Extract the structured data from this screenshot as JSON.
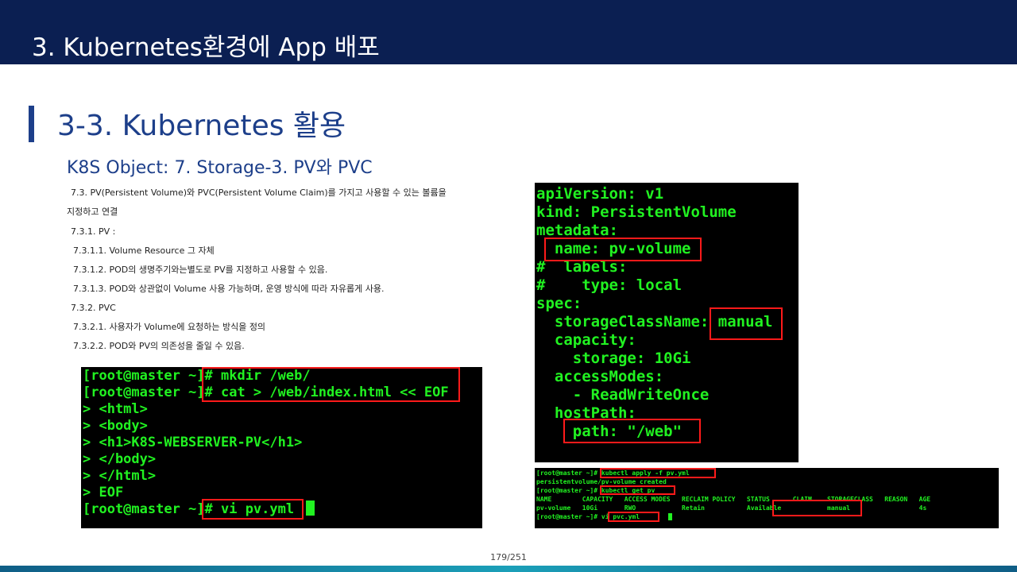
{
  "header": {
    "title": "3.  Kubernetes환경에 App 배포"
  },
  "section": {
    "title": "3-3. Kubernetes 활용"
  },
  "subtitle": "K8S Object: 7. Storage-3. PV와 PVC",
  "body_lines": [
    "7.3. PV(Persistent Volume)와 PVC(Persistent Volume Claim)를 가지고 사용할 수 있는 볼륨을",
    "지정하고 연결",
    "7.3.1. PV :",
    "7.3.1.1. Volume Resource 그 자체",
    "7.3.1.2. POD의 생명주기와는별도로 PV를 지정하고 사용할 수 있음.",
    "7.3.1.3. POD와 상관없이 Volume 사용 가능하며, 운영 방식에 따라 자유롭게 사용.",
    "7.3.2. PVC",
    "7.3.2.1. 사용자가 Volume에 요청하는 방식을 정의",
    "7.3.2.2. POD와 PV의 의존성을 줄일 수 있음."
  ],
  "terminal_left": {
    "lines": [
      "[root@master ~]# mkdir /web/",
      "[root@master ~]# cat > /web/index.html << EOF",
      "> <html>",
      "> <body>",
      "> <h1>K8S-WEBSERVER-PV</h1>",
      "> </body>",
      "> </html>",
      "> EOF",
      "[root@master ~]# vi pv.yml "
    ]
  },
  "terminal_yaml": {
    "lines": [
      "apiVersion: v1",
      "kind: PersistentVolume",
      "metadata:",
      "  name: pv-volume",
      "#  labels:",
      "#    type: local",
      "spec:",
      "  storageClassName: manual",
      "  capacity:",
      "    storage: 10Gi",
      "  accessModes:",
      "    - ReadWriteOnce",
      "  hostPath:",
      "    path: \"/web\""
    ]
  },
  "terminal_bottom": {
    "lines": [
      "[root@master ~]# kubectl apply -f pv.yml",
      "persistentvolume/pv-volume created",
      "[root@master ~]# kubectl get pv",
      "NAME        CAPACITY   ACCESS MODES   RECLAIM POLICY   STATUS      CLAIM    STORAGECLASS   REASON   AGE",
      "pv-volume   10Gi       RWO            Retain           Available            manual                  4s",
      "[root@master ~]# vi pvc.yml    "
    ]
  },
  "page_number": "179/251",
  "colors": {
    "header_bg": "#0b1f52",
    "accent": "#1d3f8a",
    "terminal_text": "#21f221",
    "highlight": "#ff1a1a"
  }
}
